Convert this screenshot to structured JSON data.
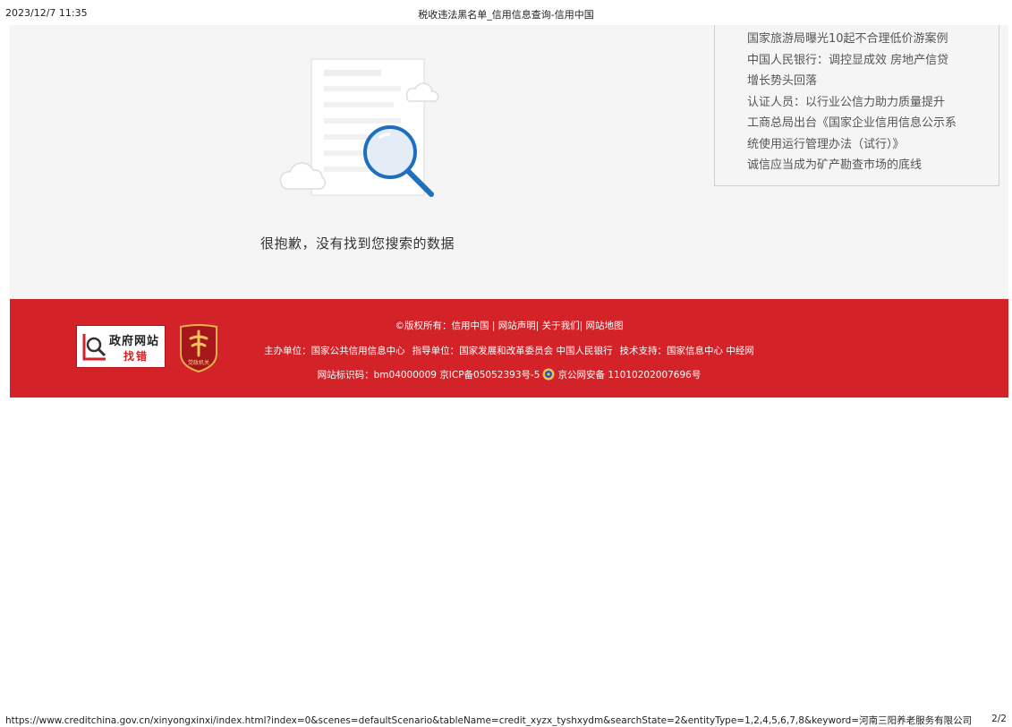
{
  "print_header": {
    "datetime": "2023/12/7 11:35",
    "title": "税收违法黑名单_信用信息查询-信用中国"
  },
  "main": {
    "empty_message": "很抱歉，没有找到您搜索的数据"
  },
  "news": {
    "items": [
      "国家旅游局曝光10起不合理低价游案例",
      "中国人民银行：调控显成效 房地产信贷",
      "增长势头回落",
      "认证人员：以行业公信力助力质量提升",
      "工商总局出台《国家企业信用信息公示系",
      "统使用运行管理办法（试行）》",
      "诚信应当成为矿产勘查市场的底线"
    ]
  },
  "footer": {
    "gov_badge_title": "政府网站",
    "gov_badge_sub": "找错",
    "party_badge_text": "党政机关",
    "copyright_prefix": "©版权所有：",
    "links": [
      "信用中国",
      "网站声明",
      "关于我们",
      "网站地图"
    ],
    "host_label": "主办单位：",
    "host_value": "国家公共信用信息中心",
    "guide_label": "指导单位：",
    "guide_value": "国家发展和改革委员会 中国人民银行",
    "tech_label": "技术支持：",
    "tech_value": "国家信息中心 中经网",
    "site_id": "网站标识码：bm04000009 京ICP备05052393号-5",
    "police_record": "京公网安备 11010202007696号"
  },
  "print_footer": {
    "url": "https://www.creditchina.gov.cn/xinyongxinxi/index.html?index=0&scenes=defaultScenario&tableName=credit_xyzx_tyshxydm&searchState=2&entityType=1,2,4,5,6,7,8&keyword=河南三阳养老服务有限公司",
    "page": "2/2"
  },
  "colors": {
    "footer_red": "#d32228",
    "content_bg": "#f5f5f5",
    "search_blue": "#1f6fc0"
  }
}
